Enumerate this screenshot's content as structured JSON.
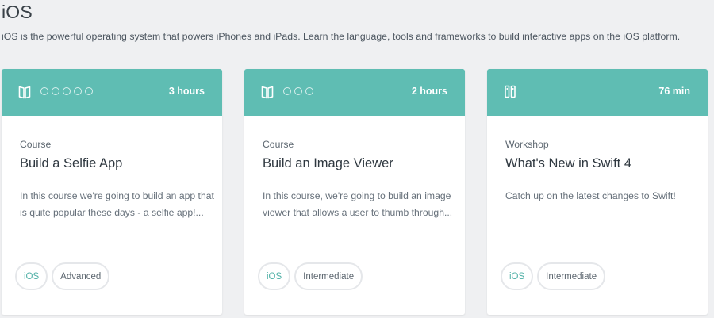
{
  "page": {
    "title": "iOS",
    "description": "iOS is the powerful operating system that powers iPhones and iPads. Learn the language, tools and frameworks to build interactive apps on the iOS platform."
  },
  "colors": {
    "header_teal": "#5fbdb3",
    "background": "#eff0f2",
    "topic_tag_text": "#4fb0a6"
  },
  "cards": [
    {
      "icon": "book-icon",
      "progress_dots": 5,
      "duration": "3 hours",
      "type": "Course",
      "title": "Build a Selfie App",
      "description": "In this course we're going to build an app that is quite popular these days - a selfie app!...",
      "topic_tag": "iOS",
      "level_tag": "Advanced"
    },
    {
      "icon": "book-icon",
      "progress_dots": 3,
      "duration": "2 hours",
      "type": "Course",
      "title": "Build an Image Viewer",
      "description": "In this course, we're going to build an image viewer that allows a user to thumb through...",
      "topic_tag": "iOS",
      "level_tag": "Intermediate"
    },
    {
      "icon": "workshop-icon",
      "progress_dots": 0,
      "duration": "76 min",
      "type": "Workshop",
      "title": "What's New in Swift 4",
      "description": "Catch up on the latest changes to Swift!",
      "topic_tag": "iOS",
      "level_tag": "Intermediate"
    }
  ]
}
